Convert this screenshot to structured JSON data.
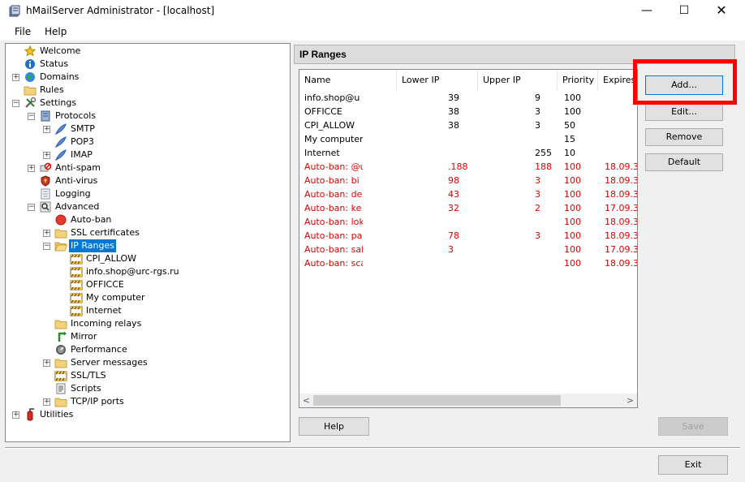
{
  "window": {
    "title": "hMailServer Administrator - [localhost]",
    "min_glyph": "—",
    "max_glyph": "☐",
    "close_glyph": "✕"
  },
  "menu": {
    "file": "File",
    "help": "Help"
  },
  "tree": [
    {
      "label": "Welcome",
      "icon": "star-icon",
      "level": 0
    },
    {
      "label": "Status",
      "icon": "info-icon",
      "level": 0
    },
    {
      "label": "Domains",
      "icon": "globe-icon",
      "level": 0,
      "expander": "+"
    },
    {
      "label": "Rules",
      "icon": "folder-icon",
      "level": 0
    },
    {
      "label": "Settings",
      "icon": "tools-icon",
      "level": 0,
      "expander": "−"
    },
    {
      "label": "Protocols",
      "icon": "server-icon",
      "level": 1,
      "expander": "−"
    },
    {
      "label": "SMTP",
      "icon": "feather-icon",
      "level": 2,
      "expander": "+"
    },
    {
      "label": "POP3",
      "icon": "feather-icon",
      "level": 2
    },
    {
      "label": "IMAP",
      "icon": "feather-icon",
      "level": 2,
      "expander": "+"
    },
    {
      "label": "Anti-spam",
      "icon": "no-spam-icon",
      "level": 1,
      "expander": "+"
    },
    {
      "label": "Anti-virus",
      "icon": "shield-icon",
      "level": 1
    },
    {
      "label": "Logging",
      "icon": "log-icon",
      "level": 1
    },
    {
      "label": "Advanced",
      "icon": "magnifier-icon",
      "level": 1,
      "expander": "−"
    },
    {
      "label": "Auto-ban",
      "icon": "red-circle-icon",
      "level": 2
    },
    {
      "label": "SSL certificates",
      "icon": "folder-icon",
      "level": 2,
      "expander": "+"
    },
    {
      "label": "IP Ranges",
      "icon": "folder-open-icon",
      "level": 2,
      "expander": "−",
      "selected": true
    },
    {
      "label": "CPI_ALLOW",
      "icon": "ip-range-icon",
      "level": 3
    },
    {
      "label": "info.shop@urc-rgs.ru",
      "icon": "ip-range-icon",
      "level": 3
    },
    {
      "label": "OFFICCE",
      "icon": "ip-range-icon",
      "level": 3
    },
    {
      "label": "My computer",
      "icon": "ip-range-icon",
      "level": 3
    },
    {
      "label": "Internet",
      "icon": "ip-range-icon",
      "level": 3
    },
    {
      "label": "Incoming relays",
      "icon": "folder-icon",
      "level": 2
    },
    {
      "label": "Mirror",
      "icon": "mirror-icon",
      "level": 2
    },
    {
      "label": "Performance",
      "icon": "gauge-icon",
      "level": 2
    },
    {
      "label": "Server messages",
      "icon": "folder-icon",
      "level": 2,
      "expander": "+"
    },
    {
      "label": "SSL/TLS",
      "icon": "ip-range-icon",
      "level": 2
    },
    {
      "label": "Scripts",
      "icon": "script-icon",
      "level": 2
    },
    {
      "label": "TCP/IP ports",
      "icon": "folder-icon",
      "level": 2,
      "expander": "+"
    },
    {
      "label": "Utilities",
      "icon": "fire-extinguisher-icon",
      "level": 0,
      "expander": "+"
    }
  ],
  "panel": {
    "title": "IP Ranges",
    "columns": [
      "Name",
      "Lower IP",
      "Upper IP",
      "Priority",
      "Expires"
    ],
    "rows": [
      {
        "name": "info.shop@u",
        "lower": "39",
        "upper": "9",
        "priority": "100",
        "expires": "",
        "color": "#000000"
      },
      {
        "name": "OFFICCE",
        "lower": "38",
        "upper": "3",
        "priority": "100",
        "expires": "",
        "color": "#000000"
      },
      {
        "name": "CPI_ALLOW",
        "lower": "38",
        "upper": "3",
        "priority": "50",
        "expires": "",
        "color": "#000000"
      },
      {
        "name": "My computer",
        "lower": "",
        "upper": "",
        "priority": "15",
        "expires": "",
        "color": "#000000"
      },
      {
        "name": "Internet",
        "lower": "",
        "upper": "255",
        "priority": "10",
        "expires": "",
        "color": "#000000"
      },
      {
        "name": "Auto-ban: @u",
        "lower": ".188",
        "upper": "188",
        "priority": "100",
        "expires": "18.09.3",
        "color": "#e00000"
      },
      {
        "name": "Auto-ban: bi",
        "lower": "98",
        "upper": "3",
        "priority": "100",
        "expires": "18.09.3",
        "color": "#e00000"
      },
      {
        "name": "Auto-ban: de",
        "lower": "43",
        "upper": "3",
        "priority": "100",
        "expires": "18.09.3",
        "color": "#e00000"
      },
      {
        "name": "Auto-ban: ke",
        "lower": "32",
        "upper": "2",
        "priority": "100",
        "expires": "17.09.3",
        "color": "#e00000"
      },
      {
        "name": "Auto-ban: lok",
        "lower": "",
        "upper": "",
        "priority": "100",
        "expires": "18.09.3",
        "color": "#e00000"
      },
      {
        "name": "Auto-ban: pa",
        "lower": "78",
        "upper": "3",
        "priority": "100",
        "expires": "18.09.3",
        "color": "#e00000"
      },
      {
        "name": "Auto-ban: sal",
        "lower": "3",
        "upper": "",
        "priority": "100",
        "expires": "17.09.3",
        "color": "#e00000"
      },
      {
        "name": "Auto-ban: scan",
        "lower": "",
        "upper": "",
        "priority": "100",
        "expires": "18.09.3",
        "color": "#e00000"
      }
    ],
    "scroll_left": "<",
    "scroll_right": ">"
  },
  "buttons": {
    "add": "Add...",
    "edit": "Edit...",
    "remove": "Remove",
    "default": "Default",
    "help": "Help",
    "save": "Save",
    "exit": "Exit"
  },
  "colors": {
    "selection": "#0078d7",
    "autoban_text": "#e00000",
    "highlight_box": "#ff0000"
  }
}
